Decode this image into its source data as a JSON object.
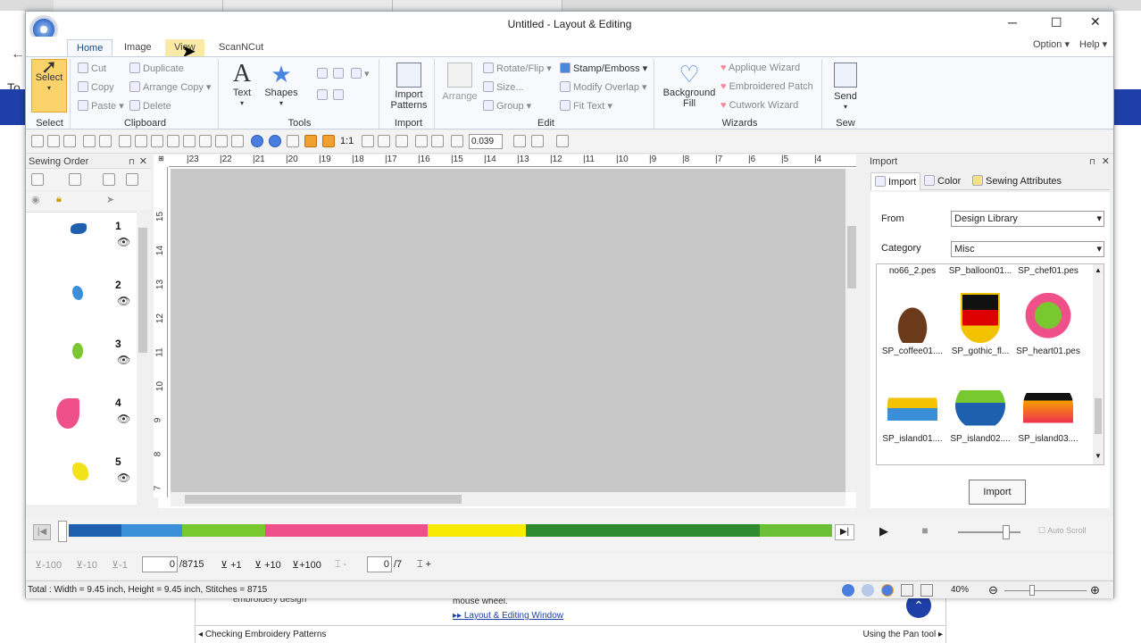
{
  "window": {
    "title": "Untitled - Layout & Editing",
    "min": "─",
    "max": "☐",
    "close": "✕"
  },
  "ribbon_tabs": [
    "Home",
    "Image",
    "View",
    "ScanNCut"
  ],
  "ribbon_right": {
    "option": "Option",
    "help": "Help"
  },
  "groups": {
    "select": {
      "label": "Select",
      "button": "Select"
    },
    "clipboard": {
      "label": "Clipboard",
      "cut": "Cut",
      "copy": "Copy",
      "paste": "Paste",
      "duplicate": "Duplicate",
      "arrange_copy": "Arrange Copy",
      "delete": "Delete"
    },
    "tools": {
      "label": "Tools",
      "text": "Text",
      "shapes": "Shapes"
    },
    "import": {
      "label": "Import",
      "button_line1": "Import",
      "button_line2": "Patterns"
    },
    "edit": {
      "label": "Edit",
      "arrange": "Arrange",
      "rotate_flip": "Rotate/Flip",
      "size": "Size...",
      "group": "Group",
      "stamp_emboss": "Stamp/Emboss",
      "modify_overlap": "Modify Overlap",
      "fit_text": "Fit Text"
    },
    "wizards": {
      "label": "Wizards",
      "background_line1": "Background",
      "background_line2": "Fill",
      "applique": "Applique Wizard",
      "embroidered_patch": "Embroidered Patch",
      "cutwork": "Cutwork Wizard"
    },
    "sew": {
      "label": "Sew",
      "send": "Send"
    }
  },
  "toolbar": {
    "zoom_value": "0.039",
    "one_to_one": "1:1"
  },
  "sewing_order": {
    "title": "Sewing Order",
    "items": [
      {
        "num": "1",
        "color": "#1f5fb0"
      },
      {
        "num": "2",
        "color": "#3a8fd8"
      },
      {
        "num": "3",
        "color": "#7ac830"
      },
      {
        "num": "4",
        "color": "#f0508a"
      },
      {
        "num": "5",
        "color": "#f2e21a"
      }
    ]
  },
  "ruler_h": [
    "|23",
    "|22",
    "|21",
    "|20",
    "|19",
    "|18",
    "|17",
    "|16",
    "|15",
    "|14",
    "|13",
    "|12",
    "|11",
    "|10",
    "|9",
    "|8",
    "|7",
    "|6",
    "|5",
    "|4"
  ],
  "ruler_v": [
    "15",
    "14",
    "13",
    "12",
    "11",
    "10",
    "9",
    "8",
    "7"
  ],
  "import_panel": {
    "title": "Import",
    "tabs": [
      "Import",
      "Color",
      "Sewing Attributes"
    ],
    "from_label": "From",
    "from_value": "Design Library",
    "category_label": "Category",
    "category_value": "Misc",
    "top_row": [
      "no66_2.pes",
      "SP_balloon01...",
      "SP_chef01.pes"
    ],
    "row2": [
      "SP_coffee01....",
      "SP_gothic_fl...",
      "SP_heart01.pes"
    ],
    "row3": [
      "SP_island01....",
      "SP_island02....",
      "SP_island03...."
    ],
    "import_button": "Import"
  },
  "colorbar": [
    {
      "color": "#1e5fb0",
      "frac": 0.07
    },
    {
      "color": "#3a8fd8",
      "frac": 0.08
    },
    {
      "color": "#7ac830",
      "frac": 0.11
    },
    {
      "color": "#f0508a",
      "frac": 0.215
    },
    {
      "color": "#f8ea00",
      "frac": 0.13
    },
    {
      "color": "#2e8b30",
      "frac": 0.31
    },
    {
      "color": "#6cc038",
      "frac": 0.095
    }
  ],
  "stitch_nav": {
    "minus100": "-100",
    "minus10": "-10",
    "minus1": "-1",
    "current": "0",
    "total": "/8715",
    "plus1": "+1",
    "plus10": "+10",
    "plus100": "+100",
    "frame_current": "0",
    "frame_total": "/7",
    "frame_add": "+"
  },
  "auto_scroll": "Auto Scroll",
  "status": {
    "text": "Total : Width = 9.45 inch, Height = 9.45 inch, Stitches = 8715",
    "zoom": "40%"
  },
  "background_page": {
    "left_char": "To",
    "snippet1": "embroidery design",
    "snippet2": "mouse wheel.",
    "link": "Layout & Editing Window",
    "prev": "Checking Embroidery Patterns",
    "next": "Using the Pan tool"
  }
}
